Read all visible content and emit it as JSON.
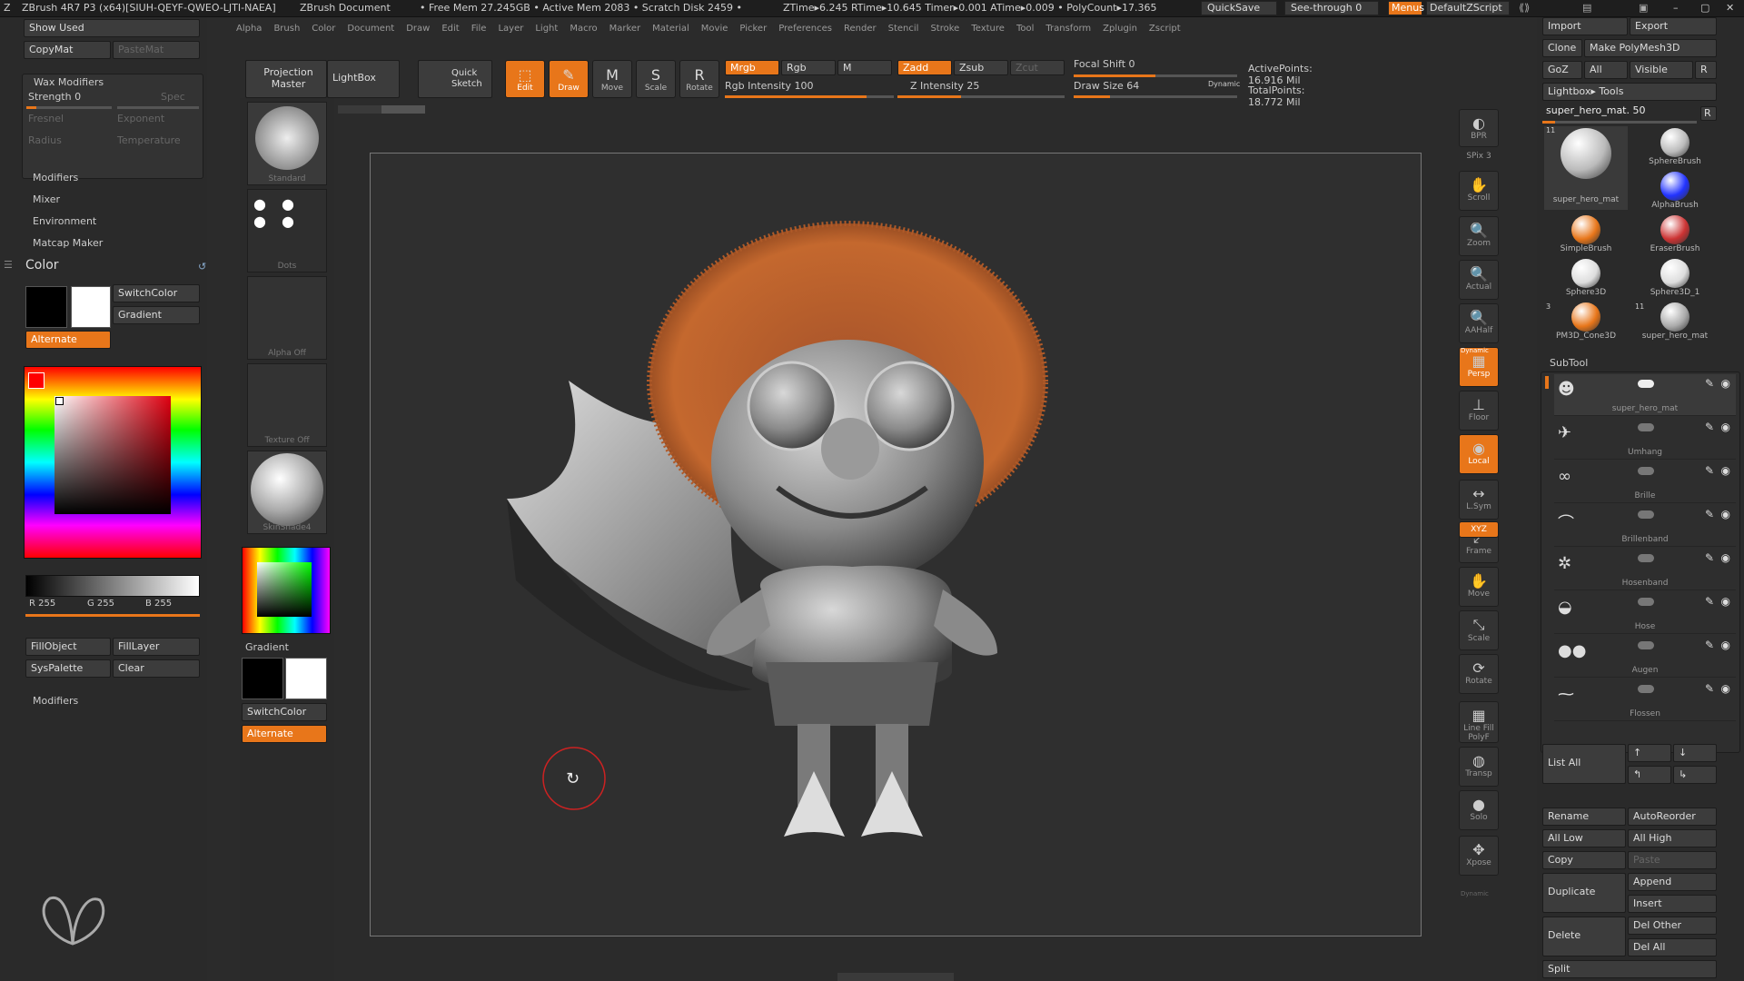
{
  "titlebar": {
    "app": "ZBrush 4R7 P3 (x64)[SIUH-QEYF-QWEO-LJTI-NAEA]",
    "doc": "ZBrush Document",
    "mem": "• Free Mem 27.245GB • Active Mem 2083 • Scratch Disk 2459 •",
    "timers": "ZTime▸6.245 RTime▸10.645 Timer▸0.001 ATime▸0.009 • PolyCount▸17.365",
    "quicksave": "QuickSave",
    "seethrough": "See-through  0",
    "menus": "Menus",
    "script": "DefaultZScript"
  },
  "menubar": [
    "Alpha",
    "Brush",
    "Color",
    "Document",
    "Draw",
    "Edit",
    "File",
    "Layer",
    "Light",
    "Macro",
    "Marker",
    "Material",
    "Movie",
    "Picker",
    "Preferences",
    "Render",
    "Stencil",
    "Stroke",
    "Texture",
    "Tool",
    "Transform",
    "Zplugin",
    "Zscript"
  ],
  "left": {
    "show_used": "Show Used",
    "copymat": "CopyMat",
    "pastemat": "PasteMat",
    "wax": "Wax Modifiers",
    "strength": "Strength 0",
    "spec": "Spec",
    "fresnel": "Fresnel",
    "exponent": "Exponent",
    "radius": "Radius",
    "temperature": "Temperature",
    "modifiers": "Modifiers",
    "mixer": "Mixer",
    "environment": "Environment",
    "matcap": "Matcap Maker",
    "color": "Color",
    "switchcolor": "SwitchColor",
    "gradient": "Gradient",
    "alternate": "Alternate",
    "r": "R 255",
    "g": "G 255",
    "b": "B 255",
    "fillobject": "FillObject",
    "filllayer": "FillLayer",
    "syspalette": "SysPalette",
    "clear": "Clear",
    "modifiers2": "Modifiers"
  },
  "col2": {
    "projection": "Projection Master",
    "lightbox": "LightBox",
    "standard": "Standard",
    "dots": "Dots",
    "alpha": "Alpha  Off",
    "texture": "Texture  Off",
    "material": "SkinShade4",
    "gradient": "Gradient",
    "switchcolor": "SwitchColor",
    "alternate": "Alternate"
  },
  "tools": {
    "quick": "Quick Sketch",
    "edit": "Edit",
    "draw": "Draw",
    "move": "Move",
    "scale": "Scale",
    "rotate": "Rotate",
    "mrgb": "Mrgb",
    "rgb": "Rgb",
    "m": "M",
    "rgb_int": "Rgb  Intensity 100",
    "zadd": "Zadd",
    "zsub": "Zsub",
    "zcut": "Zcut",
    "z_int": "Z  Intensity 25",
    "focal": "Focal  Shift 0",
    "drawsize": "Draw  Size 64",
    "dynamic": "Dynamic",
    "active": "ActivePoints: 16.916  Mil",
    "total": "TotalPoints: 18.772  Mil"
  },
  "rtool": [
    "BPR",
    "SPix 3",
    "Scroll",
    "Zoom",
    "Actual",
    "AAHalf",
    "Persp",
    "Floor",
    "Local",
    "L.Sym",
    "Frame",
    "Move",
    "Scale",
    "Rotate",
    "Line Fill PolyF",
    "Transp",
    "Solo",
    "Xpose"
  ],
  "rtool_extra": {
    "xyz": "XYZ",
    "dynamic": "Dynamic",
    "dynamic2": "Dynamic"
  },
  "right": {
    "import": "Import",
    "export": "Export",
    "clone": "Clone",
    "polymesh": "Make PolyMesh3D",
    "goz": "GoZ",
    "all": "All",
    "visible": "Visible",
    "r": "R",
    "lightbox_tools": "Lightbox▸ Tools",
    "current": "super_hero_mat. 50",
    "r2": "R",
    "num11": "11",
    "num3": "3",
    "num11b": "11",
    "brushes": [
      "super_hero_mat",
      "SphereBrush",
      "AlphaBrush",
      "SimpleBrush",
      "EraserBrush",
      "Sphere3D",
      "Sphere3D_1",
      "PM3D_Cone3D",
      "super_hero_mat"
    ],
    "subtool": "SubTool",
    "subtools": [
      "super_hero_mat",
      "Umhang",
      "Brille",
      "Brillenband",
      "Hosenband",
      "Hose",
      "Augen",
      "Flossen"
    ],
    "list_all": "List  All",
    "rename": "Rename",
    "autoreorder": "AutoReorder",
    "all_low": "All  Low",
    "all_high": "All  High",
    "copy": "Copy",
    "paste": "Paste",
    "append": "Append",
    "duplicate": "Duplicate",
    "insert": "Insert",
    "del_other": "Del  Other",
    "delete": "Delete",
    "del_all": "Del  All",
    "split": "Split"
  },
  "colors": {
    "accent": "#e8761a",
    "bg": "#2b2b2b"
  }
}
